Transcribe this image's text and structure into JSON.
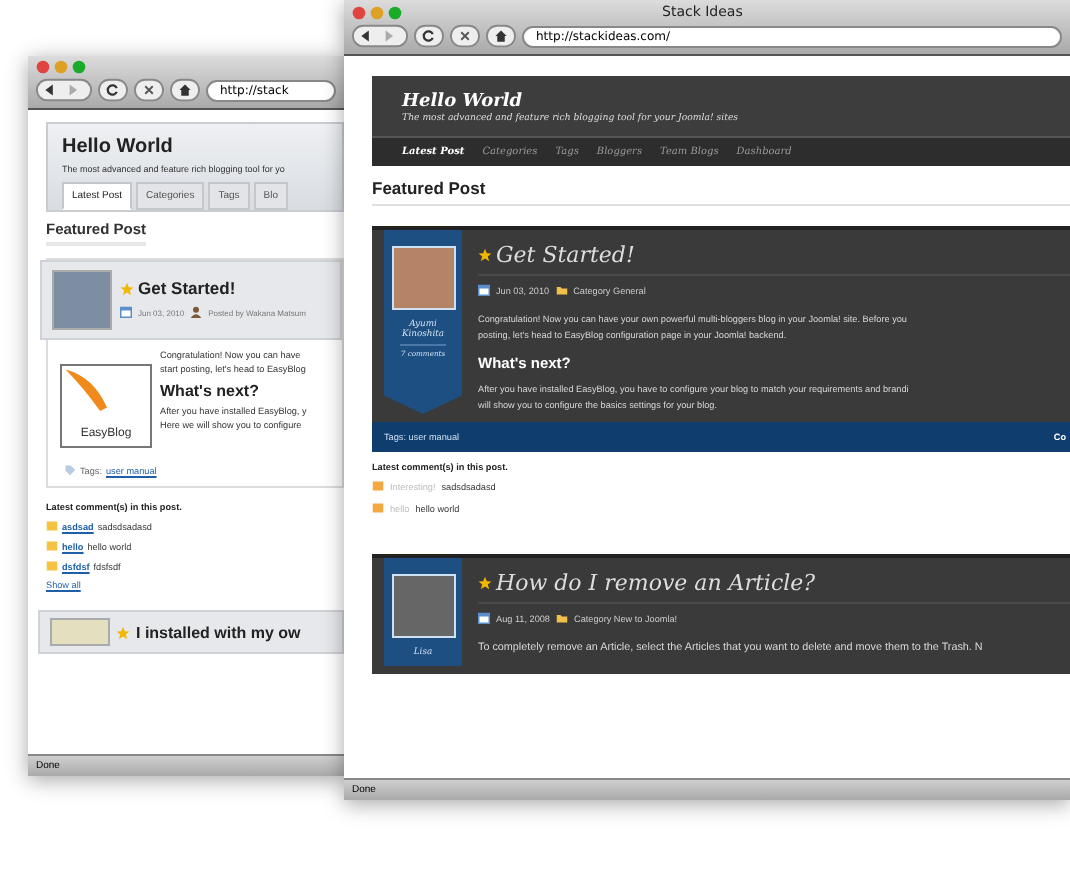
{
  "back_window": {
    "url": "http://stack",
    "site_title": "Hello World",
    "tagline": "The most advanced and feature rich blogging tool for yo",
    "tabs": [
      {
        "label": "Latest Post",
        "selected": true
      },
      {
        "label": "Categories",
        "selected": false
      },
      {
        "label": "Tags",
        "selected": false
      },
      {
        "label": "Blo",
        "selected": false
      }
    ],
    "section_title": "Featured Post",
    "post": {
      "title": "Get Started!",
      "date": "Jun 03, 2010",
      "author": "Posted by Wakana Matsum",
      "logo_text": "EasyBlog",
      "intro_lines": [
        "Congratulation! Now you can have",
        "start posting, let's head to EasyBlog"
      ],
      "subheading": "What's next?",
      "next_lines": [
        "After you have installed EasyBlog, y",
        "Here we will show you to configure"
      ],
      "tags_label": "Tags:",
      "tag": "user manual"
    },
    "comments_title": "Latest comment(s) in this post.",
    "comments": [
      {
        "author": "asdsad",
        "text": "sadsdsadasd"
      },
      {
        "author": "hello",
        "text": "hello world"
      },
      {
        "author": "dsfdsf",
        "text": "fdsfsdf"
      }
    ],
    "show_all": "Show all",
    "next_post_title": "I installed with my ow",
    "status": "Done"
  },
  "front_window": {
    "title": "Stack Ideas",
    "url": "http://stackideas.com/",
    "site_title": "Hello World",
    "tagline": "The most advanced and feature rich blogging tool for your Joomla! sites",
    "nav": [
      {
        "label": "Latest Post",
        "selected": true
      },
      {
        "label": "Categories",
        "selected": false
      },
      {
        "label": "Tags",
        "selected": false
      },
      {
        "label": "Bloggers",
        "selected": false
      },
      {
        "label": "Team Blogs",
        "selected": false
      },
      {
        "label": "Dashboard",
        "selected": false
      }
    ],
    "section_title": "Featured Post",
    "post": {
      "author": "Ayumi Kinoshita",
      "comment_count": "7 comments",
      "title": "Get Started!",
      "date": "Jun 03, 2010",
      "category": "Category General",
      "intro_lines": [
        "Congratulation! Now you can have your own powerful multi-bloggers blog in your Joomla! site. Before you",
        "posting, let's head to EasyBlog configuration page in your Joomla! backend."
      ],
      "subheading": "What's next?",
      "next_lines": [
        "After you have installed EasyBlog, you have to configure your blog to match your requirements and brandi",
        "will show you to configure the basics settings for your blog."
      ],
      "tags": "Tags: user manual",
      "footer_right": "Co"
    },
    "comments_title": "Latest comment(s) in this post.",
    "comments": [
      {
        "author": "Interesting!",
        "text": "sadsdsadasd"
      },
      {
        "author": "hello",
        "text": "hello world"
      }
    ],
    "next_post": {
      "author": "Lisa",
      "title": "How do I remove an Article?",
      "date": "Aug 11, 2008",
      "category": "Category New to Joomla!",
      "line": "To completely remove an Article, select the Articles that you want to delete and move them to the Trash. N"
    },
    "status": "Done"
  }
}
